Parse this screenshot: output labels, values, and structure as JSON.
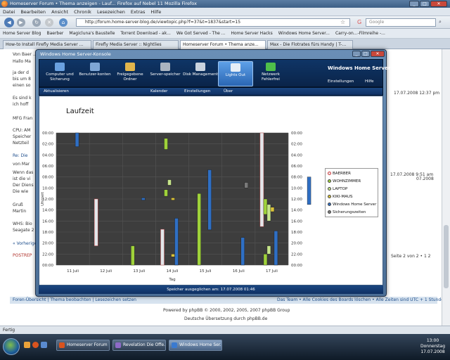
{
  "browser": {
    "window_title": "Homeserver Forum • Thema anzeigen - Lauf... Firefox auf Nebel 11 Mozilla Firefox",
    "menu": [
      "Datei",
      "Bearbeiten",
      "Ansicht",
      "Chronik",
      "Lesezeichen",
      "Extras",
      "Hilfe"
    ],
    "url": "http://forum.home-server-blog.de/viewtopic.php?f=37&t=1837&start=15",
    "search_placeholder": "Google",
    "bookmarks": [
      "Home Server Blog",
      "Baerber",
      "Magicluna's Baustelle",
      "Torrent Download - ak...",
      "We Got Served - The ...",
      "Home Server Hacks",
      "Windows Home Server...",
      "Carry-on...-Filmreihe -..."
    ],
    "tabs": [
      "How-to Install Firefly Media Server ...",
      "Firefly Media Server :: Nightlies",
      "Homeserver Forum • Thema anze...",
      "Max - Die Flotrates fürs Handy | T-..."
    ],
    "status": "Fertig"
  },
  "forum": {
    "lines": [
      {
        "text": "Von Baer ...",
        "cls": "ftext"
      },
      {
        "text": "Hallo Ma",
        "cls": "ftext"
      },
      {
        "text": "ja der d",
        "cls": "ftext"
      },
      {
        "text": "bis um 8",
        "cls": "ftext"
      },
      {
        "text": "einen so",
        "cls": "ftext"
      },
      {
        "text": "Es sind k",
        "cls": "ftext"
      },
      {
        "text": "ich hoff",
        "cls": "ftext"
      },
      {
        "text": "MFG Fran",
        "cls": "ftext"
      },
      {
        "text": "CPU: AM",
        "cls": "ftext"
      },
      {
        "text": "Speicher",
        "cls": "ftext"
      },
      {
        "text": "Netzteil",
        "cls": "ftext"
      },
      {
        "text": "Re: Die",
        "cls": "ftext fblue"
      },
      {
        "text": "von Mar",
        "cls": "ftext"
      },
      {
        "text": "Wenn das",
        "cls": "ftext"
      },
      {
        "text": "ist die vi",
        "cls": "ftext"
      },
      {
        "text": "Der Diens",
        "cls": "ftext"
      },
      {
        "text": "Die wie",
        "cls": "ftext"
      },
      {
        "text": "Gruß",
        "cls": "ftext"
      },
      {
        "text": "Martin",
        "cls": "ftext"
      },
      {
        "text": "WHS: Bio",
        "cls": "ftext"
      },
      {
        "text": "Seagate 2",
        "cls": "ftext"
      },
      {
        "text": "« Vorherige",
        "cls": "ftext fblue"
      },
      {
        "text": "POSTREP",
        "cls": "ftext fred"
      }
    ],
    "right_dates": [
      "17.07.2008 12:37 pm",
      "17.07.2008 9:51 am",
      "07.2008"
    ],
    "pagination": "Seite 2 von 2 • 1 2",
    "bottom_bar": "Foren-Übersicht | Thema beobachten | Lesezeichen setzen",
    "bottom_bar_right": "Das Team • Alle Cookies des Boards löschen • Alle Zeiten sind UTC + 1 Stunde",
    "powered": "Powered by phpBB © 2000, 2002, 2005, 2007 phpBB Group",
    "translation": "Deutsche Übersetzung durch phpBB.de"
  },
  "whs": {
    "title": "Windows Home Server-Konsole",
    "tabs": [
      {
        "label": "Computer und Sicherung",
        "color": "#6aa1e0"
      },
      {
        "label": "Benutzer-konten",
        "color": "#7fa7d6"
      },
      {
        "label": "Freigegebene Ordner",
        "color": "#e2b64c"
      },
      {
        "label": "Server-speicher",
        "color": "#aab4c0"
      },
      {
        "label": "Disk Management",
        "color": "#c9d3df"
      },
      {
        "label": "Lights Out",
        "color": "#e6eef7"
      },
      {
        "label": "Netzwerk Fehlerfrei",
        "color": "#4fbf4a"
      }
    ],
    "brand": "Windows Home Server",
    "link_settings": "Einstellungen",
    "link_help": "Hilfe",
    "toolbar": {
      "refresh": "Aktualisieren",
      "calendar": "Kalender",
      "settings": "Einstellungen",
      "about": "Über"
    },
    "footer": "Speicher ausgeglichen am: 17.07.2008 01:46"
  },
  "chart_data": {
    "type": "timeline",
    "title": "Laufzeit",
    "xlabel": "Tag",
    "ylabel": "Uhrzeit",
    "categories": [
      "11 Juli",
      "12 Juli",
      "13 Juli",
      "14 Juli",
      "15 Juli",
      "16 Juli",
      "17 Juli"
    ],
    "y_ticks": [
      "00:00",
      "02:00",
      "04:00",
      "06:00",
      "08:00",
      "10:00",
      "12:00",
      "14:00",
      "16:00",
      "18:00",
      "20:00",
      "22:00",
      "00:00"
    ],
    "y_range": [
      0,
      24
    ],
    "series": [
      {
        "name": "BAERBER",
        "color": "#e2e6ea",
        "edge": "#d43a3a",
        "intervals": [
          [
            1,
            12.0,
            20.5
          ],
          [
            3,
            17.5,
            24.0
          ],
          [
            6,
            0.0,
            17.0
          ]
        ]
      },
      {
        "name": "WOHNZIMMER",
        "color": "#9fd23a",
        "intervals": [
          [
            2,
            20.5,
            24.0
          ],
          [
            3,
            1.0,
            3.0
          ],
          [
            3,
            10.3,
            11.5
          ],
          [
            4,
            11.0,
            24.0
          ],
          [
            6,
            22.0,
            24.0
          ],
          [
            6,
            12.0,
            14.8
          ]
        ]
      },
      {
        "name": "LAPTOP",
        "color": "#c6e58a",
        "intervals": [
          [
            3,
            8.5,
            9.5
          ],
          [
            6,
            13.0,
            16.0
          ],
          [
            6,
            20.5,
            22.0
          ]
        ]
      },
      {
        "name": "KIKI-MAUS",
        "color": "#d9c23a",
        "intervals": [
          [
            3,
            11.8,
            12.2
          ],
          [
            6,
            13.5,
            14.3
          ],
          [
            3,
            22.0,
            22.5
          ]
        ]
      },
      {
        "name": "Windows Home Server",
        "color": "#2f6fc4",
        "intervals": [
          [
            0,
            0.0,
            2.5
          ],
          [
            4,
            6.7,
            17.6
          ],
          [
            2,
            11.8,
            12.2
          ],
          [
            3,
            15.5,
            24.0
          ],
          [
            6,
            17.8,
            24.0
          ],
          [
            7,
            8.0,
            13.0
          ],
          [
            5,
            19.0,
            24.0
          ]
        ]
      },
      {
        "name": "Sicherungszeiten",
        "color": "#7a7a7a",
        "intervals": [
          [
            5,
            9.0,
            10.0
          ]
        ]
      }
    ],
    "legend_position": "right",
    "grid": true
  }
}
